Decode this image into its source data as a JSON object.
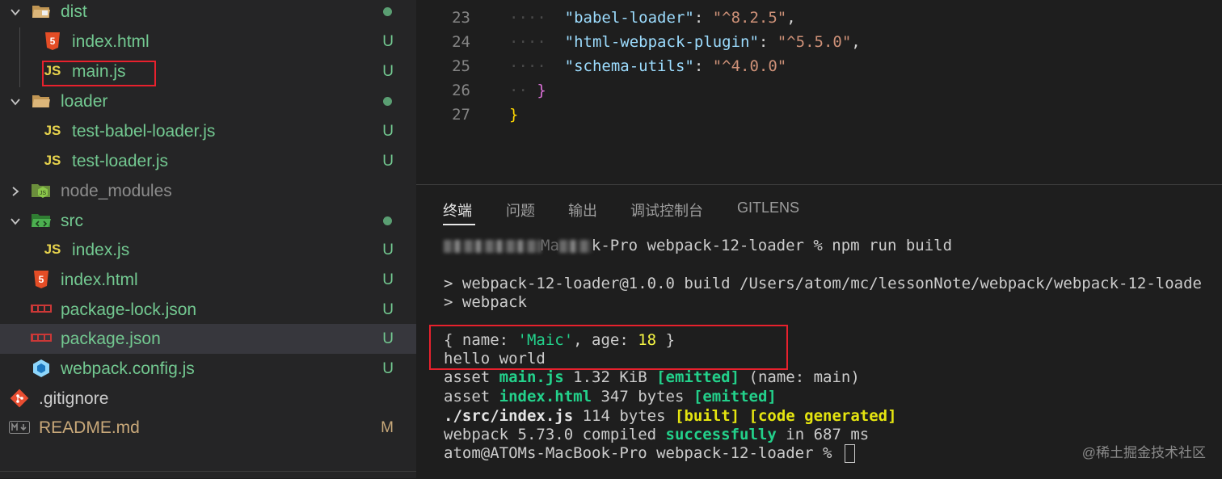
{
  "explorer": {
    "items": [
      {
        "name": "dist",
        "status": "dot"
      },
      {
        "name": "index.html",
        "status": "U"
      },
      {
        "name": "main.js",
        "status": "U"
      },
      {
        "name": "loader",
        "status": "dot"
      },
      {
        "name": "test-babel-loader.js",
        "status": "U"
      },
      {
        "name": "test-loader.js",
        "status": "U"
      },
      {
        "name": "node_modules",
        "status": ""
      },
      {
        "name": "src",
        "status": "dot"
      },
      {
        "name": "index.js",
        "status": "U"
      },
      {
        "name": "index.html",
        "status": "U"
      },
      {
        "name": "package-lock.json",
        "status": "U"
      },
      {
        "name": "package.json",
        "status": "U"
      },
      {
        "name": "webpack.config.js",
        "status": "U"
      },
      {
        "name": ".gitignore",
        "status": ""
      },
      {
        "name": "README.md",
        "status": "M"
      }
    ],
    "icons": {
      "js": "JS",
      "html": "5"
    }
  },
  "editor": {
    "lines": [
      {
        "num": "23",
        "key": "\"babel-loader\"",
        "value": "\"^8.2.5\"",
        "trail": ","
      },
      {
        "num": "24",
        "key": "\"html-webpack-plugin\"",
        "value": "\"^5.5.0\"",
        "trail": ","
      },
      {
        "num": "25",
        "key": "\"schema-utils\"",
        "value": "\"^4.0.0\"",
        "trail": ""
      },
      {
        "num": "26",
        "brace": "}"
      },
      {
        "num": "27",
        "brace": "}"
      }
    ],
    "colon": ": "
  },
  "panel": {
    "tabs": [
      "终端",
      "问题",
      "输出",
      "调试控制台",
      "GITLENS"
    ],
    "terminal": {
      "prompt_line": "k-Pro webpack-12-loader % npm run build",
      "blurred_prefix_mid": "Ma",
      "build_line": "> webpack-12-loader@1.0.0 build /Users/atom/mc/lessonNote/webpack/webpack-12-loade",
      "webpack_line": "> webpack",
      "obj": {
        "open": "{ name: ",
        "name": "'Maic'",
        "mid": ", age: ",
        "age": "18",
        "close": " }"
      },
      "hello": "hello world",
      "asset1": {
        "a": "asset ",
        "file": "main.js",
        "size": " 1.32 KiB ",
        "tag": "[emitted]",
        "rest": " (name: main)"
      },
      "asset2": {
        "a": "asset ",
        "file": "index.html",
        "size": " 347 bytes ",
        "tag": "[emitted]"
      },
      "src": {
        "file": "./src/index.js",
        "size": " 114 bytes ",
        "tag1": "[built]",
        "sp": " ",
        "tag2": "[code generated]"
      },
      "compiled": {
        "a": "webpack 5.73.0 compiled ",
        "ok": "successfully",
        "b": " in 687 ms"
      },
      "final_prompt": "atom@ATOMs-MacBook-Pro webpack-12-loader % "
    },
    "watermark": "@稀土掘金技术社区"
  },
  "colors": {
    "red_box": "#e8212d",
    "untracked": "#73c991",
    "modified": "#c9a97a"
  }
}
